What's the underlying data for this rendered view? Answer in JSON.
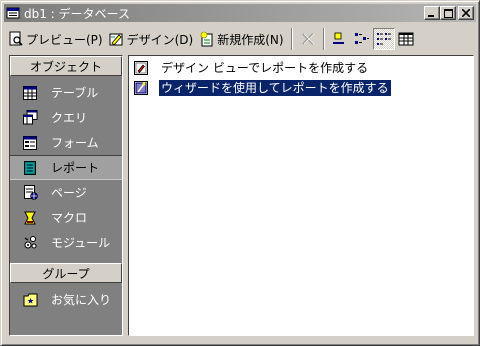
{
  "window": {
    "title": "db1 : データベース"
  },
  "toolbar": {
    "preview_label": "プレビュー(P)",
    "design_label": "デザイン(D)",
    "new_label": "新規作成(N)"
  },
  "sidebar": {
    "objects_header": "オブジェクト",
    "items": [
      {
        "label": "テーブル",
        "icon": "table-icon"
      },
      {
        "label": "クエリ",
        "icon": "query-icon"
      },
      {
        "label": "フォーム",
        "icon": "form-icon"
      },
      {
        "label": "レポート",
        "icon": "report-icon"
      },
      {
        "label": "ページ",
        "icon": "page-icon"
      },
      {
        "label": "マクロ",
        "icon": "macro-icon"
      },
      {
        "label": "モジュール",
        "icon": "module-icon"
      }
    ],
    "selected": "レポート",
    "groups_header": "グループ",
    "group_items": [
      {
        "label": "お気に入り",
        "icon": "favorites-icon"
      }
    ]
  },
  "content": {
    "items": [
      {
        "label": "デザイン ビューでレポートを作成する",
        "icon": "design-view-icon"
      },
      {
        "label": "ウィザードを使用してレポートを作成する",
        "icon": "wizard-icon"
      }
    ],
    "selected": "ウィザードを使用してレポートを作成する"
  },
  "colors": {
    "selection": "#0a246a",
    "panel": "#808080",
    "face": "#d4d0c8"
  }
}
